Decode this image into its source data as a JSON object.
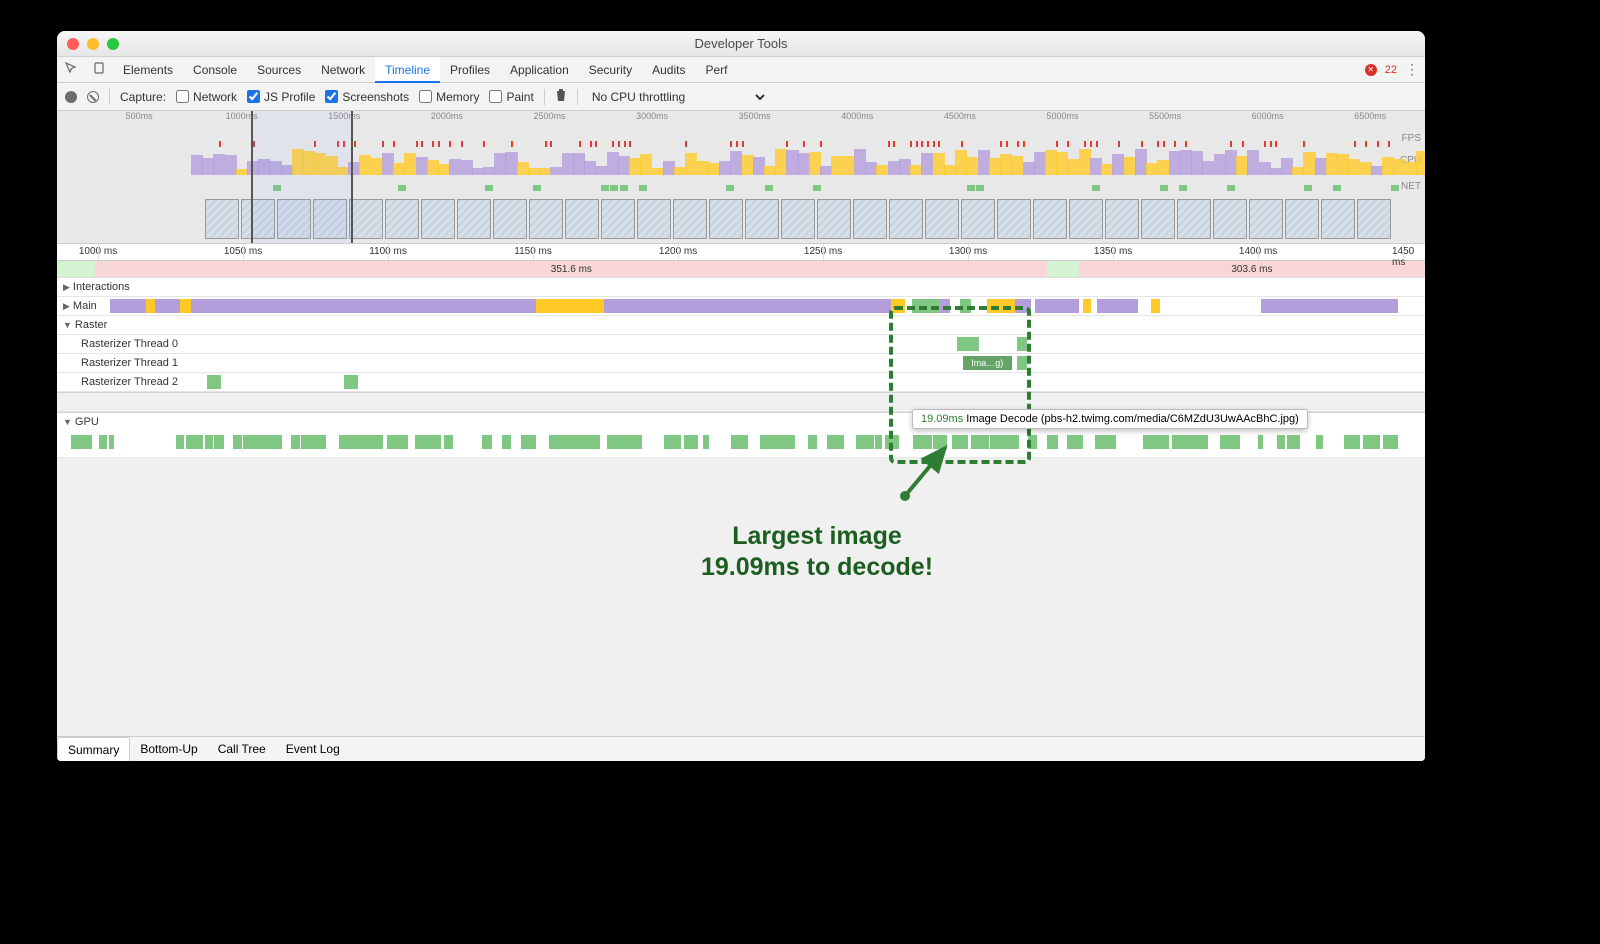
{
  "window": {
    "title": "Developer Tools"
  },
  "tabs": {
    "items": [
      "Elements",
      "Console",
      "Sources",
      "Network",
      "Timeline",
      "Profiles",
      "Application",
      "Security",
      "Audits",
      "Perf"
    ],
    "active": "Timeline",
    "error_count": "22"
  },
  "toolbar": {
    "capture_label": "Capture:",
    "network": "Network",
    "jsprofile": "JS Profile",
    "screenshots": "Screenshots",
    "memory": "Memory",
    "paint": "Paint",
    "throttle": "No CPU throttling"
  },
  "overview": {
    "ticks": [
      "500ms",
      "1000ms",
      "1500ms",
      "2000ms",
      "2500ms",
      "3000ms",
      "3500ms",
      "4000ms",
      "4500ms",
      "5000ms",
      "5500ms",
      "6000ms",
      "6500ms"
    ],
    "labels": {
      "fps": "FPS",
      "cpu": "CPU",
      "net": "NET"
    },
    "selection": {
      "start_pct": 14.2,
      "end_pct": 21.6
    }
  },
  "ruler_ticks": [
    "1000 ms",
    "1050 ms",
    "1100 ms",
    "1150 ms",
    "1200 ms",
    "1250 ms",
    "1300 ms",
    "1350 ms",
    "1400 ms",
    "1450 ms"
  ],
  "frames": {
    "a_label": "351.6 ms",
    "b_label": "303.6 ms"
  },
  "lanes": {
    "interactions": "Interactions",
    "main": "Main",
    "raster": "Raster",
    "r0": "Rasterizer Thread 0",
    "r1": "Rasterizer Thread 1",
    "r2": "Rasterizer Thread 2",
    "gpu": "GPU"
  },
  "tooltip": {
    "task_label": "Ima…g)",
    "ms": "19.09ms",
    "desc": "Image Decode (pbs-h2.twimg.com/media/C6MZdU3UwAAcBhC.jpg)"
  },
  "annotation": {
    "line1": "Largest image",
    "line2": "19.09ms to decode!"
  },
  "footer": {
    "tabs": [
      "Summary",
      "Bottom-Up",
      "Call Tree",
      "Event Log"
    ],
    "active": "Summary"
  }
}
